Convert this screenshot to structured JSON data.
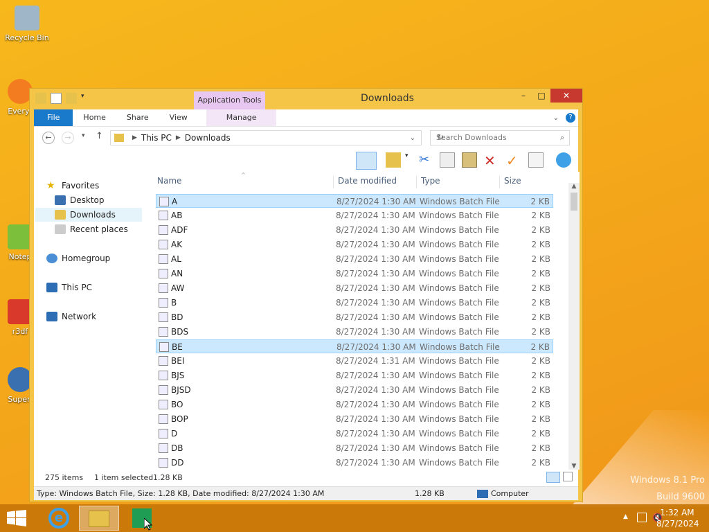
{
  "desktop": {
    "icons": [
      {
        "label": "Recycle Bin",
        "color": "#9fb6c8"
      },
      {
        "label": "Everyt",
        "color": "#f47c20"
      },
      {
        "label": "Notep",
        "color": "#7bbf3a"
      },
      {
        "label": "r3df",
        "color": "#d9392a"
      },
      {
        "label": "Superi",
        "color": "#3a6fb0"
      }
    ],
    "watermark_line1": "Windows 8.1 Pro",
    "watermark_line2": "Build 9600"
  },
  "window": {
    "title": "Downloads",
    "app_tools_label": "Application Tools",
    "buttons": {
      "minimize": "–",
      "maximize": "□",
      "close": "✕"
    }
  },
  "ribbon": {
    "tabs": {
      "file": "File",
      "home": "Home",
      "share": "Share",
      "view": "View",
      "manage": "Manage"
    },
    "help": "?"
  },
  "address": {
    "crumbs": [
      "This PC",
      "Downloads"
    ],
    "search_placeholder": "Search Downloads"
  },
  "nav": {
    "favorites": "Favorites",
    "desktop": "Desktop",
    "downloads": "Downloads",
    "recent": "Recent places",
    "homegroup": "Homegroup",
    "thispc": "This PC",
    "network": "Network"
  },
  "columns": {
    "name": "Name",
    "date": "Date modified",
    "type": "Type",
    "size": "Size"
  },
  "files": [
    {
      "name": "A",
      "date": "8/27/2024 1:30 AM",
      "type": "Windows Batch File",
      "size": "2 KB",
      "selected": true
    },
    {
      "name": "AB",
      "date": "8/27/2024 1:30 AM",
      "type": "Windows Batch File",
      "size": "2 KB"
    },
    {
      "name": "ADF",
      "date": "8/27/2024 1:30 AM",
      "type": "Windows Batch File",
      "size": "2 KB"
    },
    {
      "name": "AK",
      "date": "8/27/2024 1:30 AM",
      "type": "Windows Batch File",
      "size": "2 KB"
    },
    {
      "name": "AL",
      "date": "8/27/2024 1:30 AM",
      "type": "Windows Batch File",
      "size": "2 KB"
    },
    {
      "name": "AN",
      "date": "8/27/2024 1:30 AM",
      "type": "Windows Batch File",
      "size": "2 KB"
    },
    {
      "name": "AW",
      "date": "8/27/2024 1:30 AM",
      "type": "Windows Batch File",
      "size": "2 KB"
    },
    {
      "name": "B",
      "date": "8/27/2024 1:30 AM",
      "type": "Windows Batch File",
      "size": "2 KB"
    },
    {
      "name": "BD",
      "date": "8/27/2024 1:30 AM",
      "type": "Windows Batch File",
      "size": "2 KB"
    },
    {
      "name": "BDS",
      "date": "8/27/2024 1:30 AM",
      "type": "Windows Batch File",
      "size": "2 KB"
    },
    {
      "name": "BE",
      "date": "8/27/2024 1:30 AM",
      "type": "Windows Batch File",
      "size": "2 KB",
      "selected": true
    },
    {
      "name": "BEI",
      "date": "8/27/2024 1:31 AM",
      "type": "Windows Batch File",
      "size": "2 KB"
    },
    {
      "name": "BJS",
      "date": "8/27/2024 1:30 AM",
      "type": "Windows Batch File",
      "size": "2 KB"
    },
    {
      "name": "BJSD",
      "date": "8/27/2024 1:30 AM",
      "type": "Windows Batch File",
      "size": "2 KB"
    },
    {
      "name": "BO",
      "date": "8/27/2024 1:30 AM",
      "type": "Windows Batch File",
      "size": "2 KB"
    },
    {
      "name": "BOP",
      "date": "8/27/2024 1:30 AM",
      "type": "Windows Batch File",
      "size": "2 KB"
    },
    {
      "name": "D",
      "date": "8/27/2024 1:30 AM",
      "type": "Windows Batch File",
      "size": "2 KB"
    },
    {
      "name": "DB",
      "date": "8/27/2024 1:30 AM",
      "type": "Windows Batch File",
      "size": "2 KB"
    },
    {
      "name": "DD",
      "date": "8/27/2024 1:30 AM",
      "type": "Windows Batch File",
      "size": "2 KB"
    }
  ],
  "status": {
    "count": "275 items",
    "selected": "1 item selected",
    "size": "1.28 KB"
  },
  "details": {
    "info": "Type: Windows Batch File, Size: 1.28 KB, Date modified: 8/27/2024 1:30 AM",
    "size": "1.28 KB",
    "location": "Computer"
  },
  "taskbar": {
    "time": "1:32 AM",
    "date": "8/27/2024"
  },
  "colors": {
    "accent": "#1979ca",
    "close": "#c7392f",
    "frame": "#f5c547"
  }
}
